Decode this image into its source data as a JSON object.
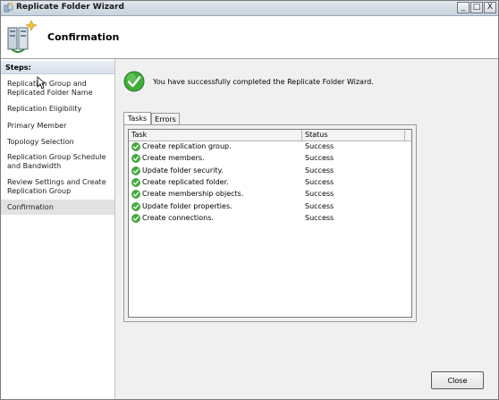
{
  "window": {
    "title": "Replicate Folder Wizard"
  },
  "window_controls": {
    "minimize": "_",
    "maximize": "□",
    "close": "X"
  },
  "header": {
    "title": "Confirmation"
  },
  "steps": {
    "title": "Steps:",
    "items": [
      {
        "label_line1": "Replication Group and",
        "label_line2": "Replicated Folder Name"
      },
      {
        "label_line1": "Replication Eligibility",
        "label_line2": ""
      },
      {
        "label_line1": "Primary Member",
        "label_line2": ""
      },
      {
        "label_line1": "Topology Selection",
        "label_line2": ""
      },
      {
        "label_line1": "Replication Group Schedule",
        "label_line2": "and Bandwidth"
      },
      {
        "label_line1": "Review Settings and Create",
        "label_line2": "Replication Group"
      },
      {
        "label_line1": "Confirmation",
        "label_line2": ""
      }
    ],
    "active_index": 6
  },
  "message": "You have successfully completed the Replicate Folder Wizard.",
  "tabs": [
    {
      "label": "Tasks"
    },
    {
      "label": "Errors"
    }
  ],
  "table": {
    "columns": [
      "Task",
      "Status"
    ],
    "rows": [
      {
        "task": "Create replication group.",
        "status": "Success"
      },
      {
        "task": "Create members.",
        "status": "Success"
      },
      {
        "task": "Update folder security.",
        "status": "Success"
      },
      {
        "task": "Create replicated folder.",
        "status": "Success"
      },
      {
        "task": "Create membership objects.",
        "status": "Success"
      },
      {
        "task": "Update folder properties.",
        "status": "Success"
      },
      {
        "task": "Create connections.",
        "status": "Success"
      }
    ]
  },
  "buttons": {
    "close": "Close"
  },
  "colors": {
    "success_green": "#3fae3a",
    "header_bg": "#ffffff",
    "pane_bg": "#f0f0f0"
  },
  "icons": {
    "title": "wizard-icon",
    "header": "replication-folder-icon",
    "success": "check-circle-icon"
  }
}
